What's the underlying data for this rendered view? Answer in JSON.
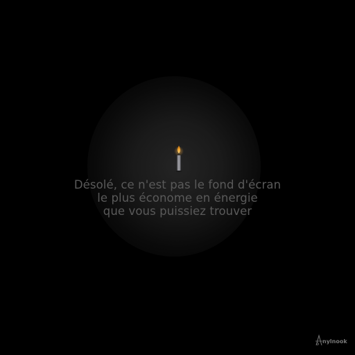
{
  "message": {
    "line1": "Désolé, ce n'est pas le fond d'écran",
    "line2": "le plus économe en énergie",
    "line3": "que vous puissiez trouver"
  },
  "logo": {
    "text": "nylnook"
  },
  "icons": {
    "candle": "candle-icon",
    "logo_mark": "nylnook-logo-mark"
  },
  "colors": {
    "background": "#000000",
    "text": "#5a5a5a",
    "flame": "#e8a020",
    "candle": "#8c8c90"
  }
}
